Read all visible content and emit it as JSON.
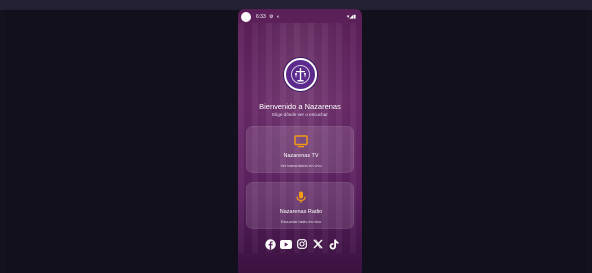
{
  "statusbar": {
    "time": "6:33",
    "icons_left": "⚙ ◐",
    "icons_right": "▾◢▮"
  },
  "welcome": {
    "title": "Bienvenido a Nazarenas",
    "subtitle": "Elige dónde ver o escuchar"
  },
  "cards": [
    {
      "icon": "tv-icon",
      "title": "Nazarenas TV",
      "subtitle": "Ver transmisión en vivo"
    },
    {
      "icon": "microphone-icon",
      "title": "Nazarenas Radio",
      "subtitle": "Escuchar radio en vivo"
    }
  ],
  "socials": [
    "facebook-icon",
    "youtube-icon",
    "instagram-icon",
    "x-icon",
    "tiktok-icon"
  ],
  "colors": {
    "accent": "#f39c12",
    "background_top": "#5a1f57",
    "logo": "#5b2a8c",
    "card": "rgba(255,255,255,0.12)"
  },
  "navbar": [
    "back-icon",
    "home-icon",
    "recents-icon"
  ]
}
